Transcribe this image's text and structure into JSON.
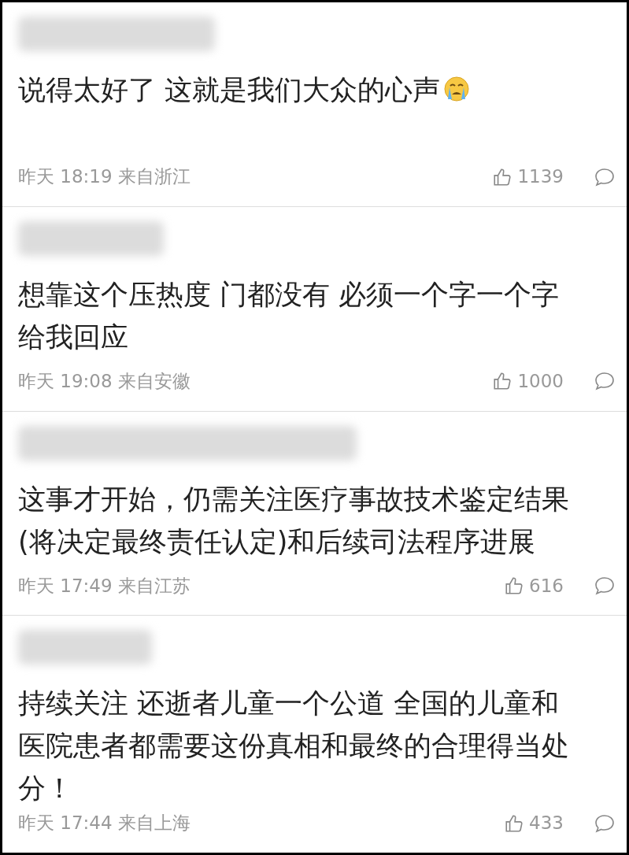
{
  "comments": [
    {
      "text": "说得太好了 这就是我们大众的心声",
      "emoji": true,
      "meta": "昨天 18:19 来自浙江",
      "likes": "1139"
    },
    {
      "text": "想靠这个压热度 门都没有 必须一个字一个字给我回应",
      "emoji": false,
      "meta": "昨天 19:08 来自安徽",
      "likes": "1000"
    },
    {
      "text": "这事才开始，仍需关注医疗事故技术鉴定结果(将决定最终责任认定)和后续司法程序进展",
      "emoji": false,
      "meta": "昨天 17:49 来自江苏",
      "likes": "616"
    },
    {
      "text": "持续关注 还逝者儿童一个公道 全国的儿童和医院患者都需要这份真相和最终的合理得当处分！",
      "emoji": false,
      "meta": "昨天 17:44 来自上海",
      "likes": "433"
    }
  ]
}
